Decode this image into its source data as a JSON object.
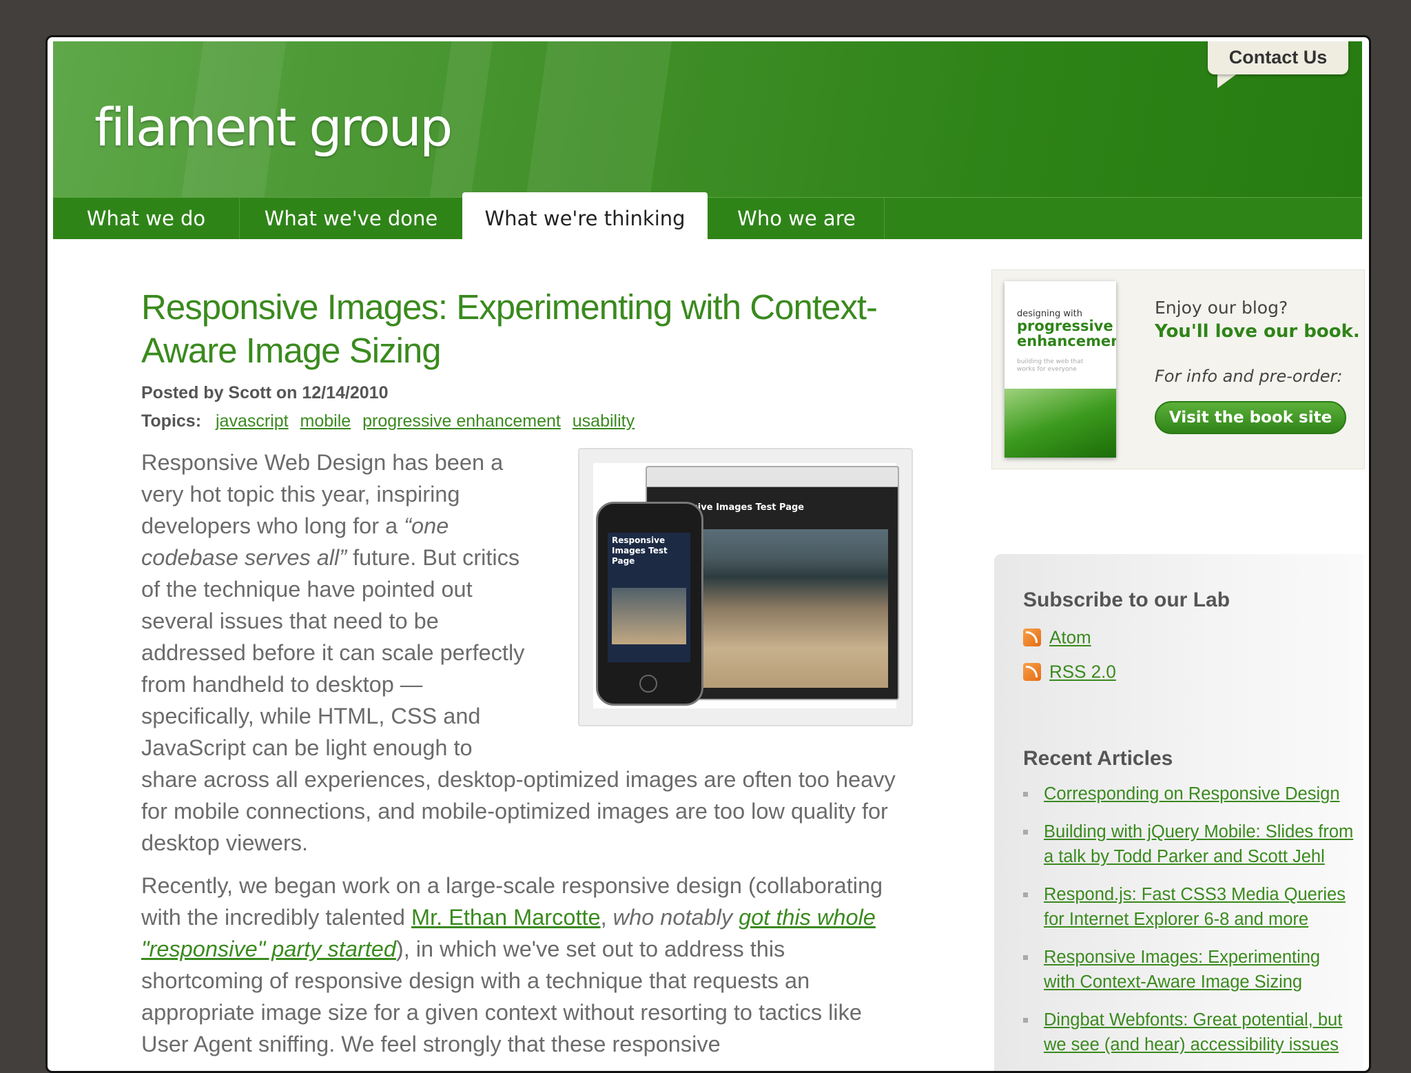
{
  "header": {
    "logo": "filament group",
    "contact": "Contact Us"
  },
  "nav": {
    "tabs": [
      {
        "label": "What we do",
        "active": false
      },
      {
        "label": "What we've done",
        "active": false
      },
      {
        "label": "What we're thinking",
        "active": true
      },
      {
        "label": "Who we are",
        "active": false
      }
    ]
  },
  "article": {
    "title": "Responsive Images: Experimenting with Context-Aware Image Sizing",
    "byline": "Posted by Scott on 12/14/2010",
    "topics_label": "Topics:",
    "topics": [
      "javascript",
      "mobile",
      "progressive enhancement",
      "usability"
    ],
    "p1_a": "Responsive Web Design has been a very hot topic this year, inspiring developers who long for a ",
    "p1_quote": "“one codebase serves all”",
    "p1_b": " future. But critics of the technique have pointed out several issues that need to be addressed before it can scale perfectly from handheld to desktop — specifically, while HTML, CSS and JavaScript can be light enough to share across all experiences, desktop-optimized images are often too heavy for mobile connections, and mobile-optimized images are too low quality for desktop viewers.",
    "p2_a": "Recently, we began work on a large-scale responsive design (collaborating with the incredibly talented ",
    "p2_link1": "Mr. Ethan Marcotte",
    "p2_b": ", ",
    "p2_em1": "who notably ",
    "p2_link2": "got this whole \"responsive\" party started",
    "p2_c": "), in which we've set out to address this shortcoming of responsive design with a technique that requests an appropriate image size for a given context without resorting to tactics like User Agent sniffing. We feel strongly that these responsive",
    "figure": {
      "browser_title": "Responsive Images Test Page",
      "phone_title": "Responsive Images Test Page"
    }
  },
  "book_promo": {
    "cover_line1": "designing with",
    "cover_line2": "progressive enhancement",
    "cover_line3": "building the web that works for everyone",
    "enjoy": "Enjoy our blog?",
    "love": "You'll love our book.",
    "preorder": "For info and pre-order:",
    "button": "Visit the book site"
  },
  "sidebar": {
    "subscribe_title": "Subscribe to our Lab",
    "feeds": [
      "Atom",
      "RSS 2.0"
    ],
    "recent_title": "Recent Articles",
    "recent": [
      "Corresponding on Responsive Design",
      "Building with jQuery Mobile: Slides from a talk by Todd Parker and Scott Jehl",
      "Respond.js: Fast CSS3 Media Queries for Internet Explorer 6-8 and more",
      "Responsive Images: Experimenting with Context-Aware Image Sizing",
      "Dingbat Webfonts: Great potential, but we see (and hear) accessibility issues"
    ]
  },
  "colors": {
    "brand_green": "#2f8418",
    "link_green": "#3a8a1e",
    "body_text": "#6b6b6b",
    "frame": "#423f3c"
  }
}
